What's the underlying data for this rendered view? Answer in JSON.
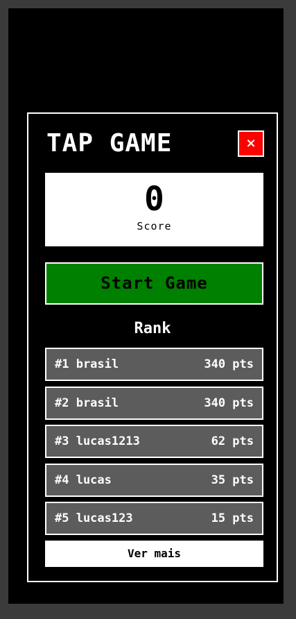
{
  "game": {
    "title": "TAP GAME",
    "close_label": "×",
    "score": {
      "value": "0",
      "label": "Score"
    },
    "start_label": "Start Game",
    "rank_title": "Rank",
    "rank": [
      {
        "label": "#1 brasil",
        "points": "340 pts"
      },
      {
        "label": "#2 brasil",
        "points": "340 pts"
      },
      {
        "label": "#3 lucas1213",
        "points": "62 pts"
      },
      {
        "label": "#4 lucas",
        "points": "35 pts"
      },
      {
        "label": "#5 lucas123",
        "points": "15 pts"
      }
    ],
    "more_label": "Ver mais"
  },
  "colors": {
    "background": "#000000",
    "outer": "#3b3b3b",
    "close": "#ff0000",
    "start": "#008000",
    "rank_row": "#5c5c5c"
  }
}
